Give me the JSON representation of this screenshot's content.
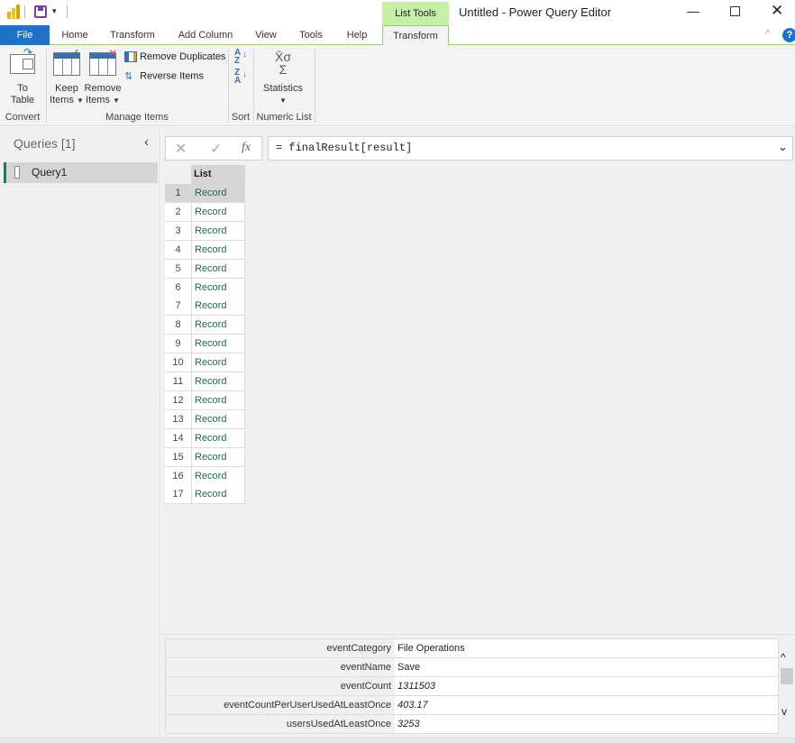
{
  "window": {
    "title": "Untitled - Power Query Editor",
    "context_tab_group": "List Tools"
  },
  "tabs": [
    {
      "label": "File"
    },
    {
      "label": "Home"
    },
    {
      "label": "Transform"
    },
    {
      "label": "Add Column"
    },
    {
      "label": "View"
    },
    {
      "label": "Tools"
    },
    {
      "label": "Help"
    },
    {
      "label": "Transform"
    }
  ],
  "ribbon": {
    "to_table": {
      "line1": "To",
      "line2": "Table"
    },
    "convert_label": "Convert",
    "keep_items": {
      "line1": "Keep",
      "line2": "Items"
    },
    "remove_items": {
      "line1": "Remove",
      "line2": "Items"
    },
    "remove_duplicates": "Remove Duplicates",
    "reverse_items": "Reverse Items",
    "manage_items_label": "Manage Items",
    "sort_label": "Sort",
    "statistics": "Statistics",
    "numeric_list_label": "Numeric List"
  },
  "queries": {
    "header": "Queries [1]",
    "items": [
      {
        "name": "Query1"
      }
    ]
  },
  "formula": {
    "fx": "fx",
    "text": "= finalResult[result]"
  },
  "grid": {
    "header": "List",
    "rows": [
      "Record",
      "Record",
      "Record",
      "Record",
      "Record",
      "Record",
      "Record",
      "Record",
      "Record",
      "Record",
      "Record",
      "Record",
      "Record",
      "Record",
      "Record",
      "Record",
      "Record"
    ]
  },
  "details": [
    {
      "key": "eventCategory",
      "value": "File Operations",
      "italic": false
    },
    {
      "key": "eventName",
      "value": "Save",
      "italic": false
    },
    {
      "key": "eventCount",
      "value": "1311503",
      "italic": true
    },
    {
      "key": "eventCountPerUserUsedAtLeastOnce",
      "value": "403.17",
      "italic": true
    },
    {
      "key": "usersUsedAtLeastOnce",
      "value": "3253",
      "italic": true
    }
  ],
  "colors": {
    "accent": "#1e73c8",
    "context_green": "#c6efa8",
    "record_text": "#1e6b52"
  }
}
